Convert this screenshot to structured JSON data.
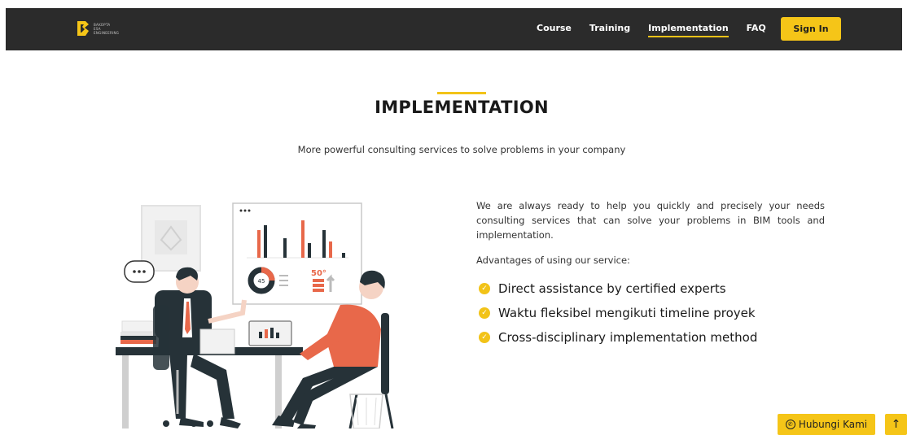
{
  "header": {
    "logo_lines": [
      "BAKOPTA",
      "ESA",
      "ENGINEERING"
    ],
    "nav": [
      {
        "label": "Course",
        "active": false
      },
      {
        "label": "Training",
        "active": false
      },
      {
        "label": "Implementation",
        "active": true
      },
      {
        "label": "FAQ",
        "active": false
      }
    ],
    "sign_in_label": "Sign In"
  },
  "hero": {
    "title": "IMPLEMENTATION",
    "subtitle": "More powerful consulting services to solve problems in your company"
  },
  "content": {
    "description": "We are always ready to help you quickly and precisely your needs consulting services that can solve your problems in BIM tools and implementation.",
    "advantages_label": "Advantages of using our service:",
    "advantages": [
      "Direct assistance by certified experts",
      "Waktu fleksibel mengikuti timeline proyek",
      "Cross-disciplinary implementation method"
    ]
  },
  "illustration": {
    "badge_50": "50°",
    "donut_value": "45"
  },
  "floating": {
    "contact_label": "Hubungi Kami",
    "back_to_top_icon": "arrow-up-icon"
  },
  "colors": {
    "accent": "#f5c518",
    "navbar": "#2b2b2b",
    "shirt": "#e8684a",
    "suit": "#263238"
  }
}
